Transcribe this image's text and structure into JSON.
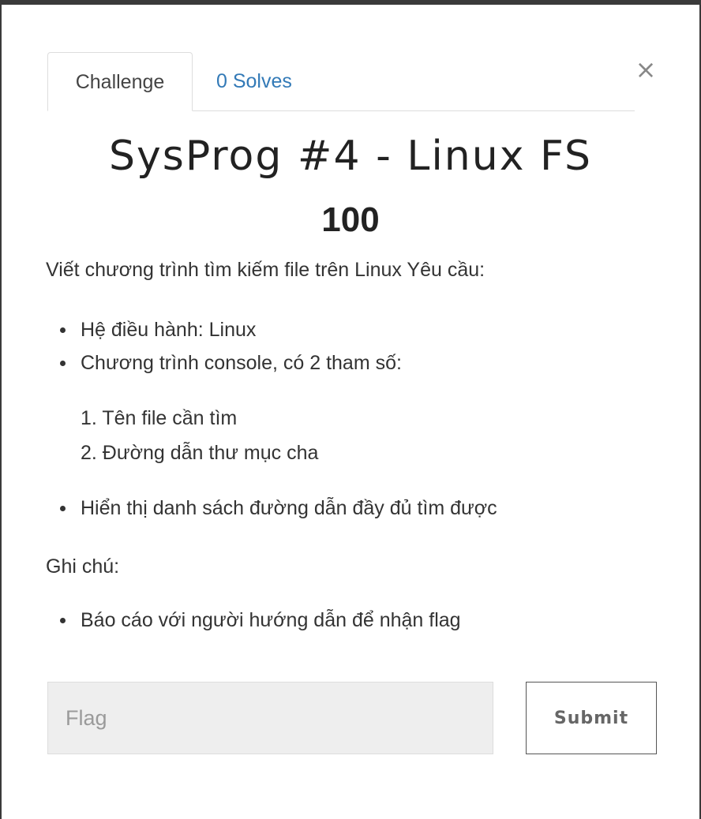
{
  "tabs": [
    {
      "label": "Challenge",
      "active": true
    },
    {
      "label": "0 Solves",
      "active": false
    }
  ],
  "close_icon": "×",
  "challenge": {
    "title": "SysProg #4 - Linux FS",
    "value": "100",
    "intro": "Viết chương trình tìm kiếm file trên Linux Yêu cầu:",
    "requirements": [
      "Hệ điều hành: Linux",
      "Chương trình console, có 2 tham số:"
    ],
    "params": [
      "1. Tên file cần tìm",
      "2. Đường dẫn thư mục cha"
    ],
    "output": [
      "Hiển thị danh sách đường dẫn đầy đủ tìm được"
    ],
    "note_heading": "Ghi chú:",
    "notes": [
      "Báo cáo với người hướng dẫn để nhận flag"
    ]
  },
  "form": {
    "flag_placeholder": "Flag",
    "flag_value": "",
    "submit_label": "Submit"
  },
  "colors": {
    "link": "#337ab7",
    "input_bg": "#eeeeee",
    "backdrop": "#3a3a3a"
  }
}
